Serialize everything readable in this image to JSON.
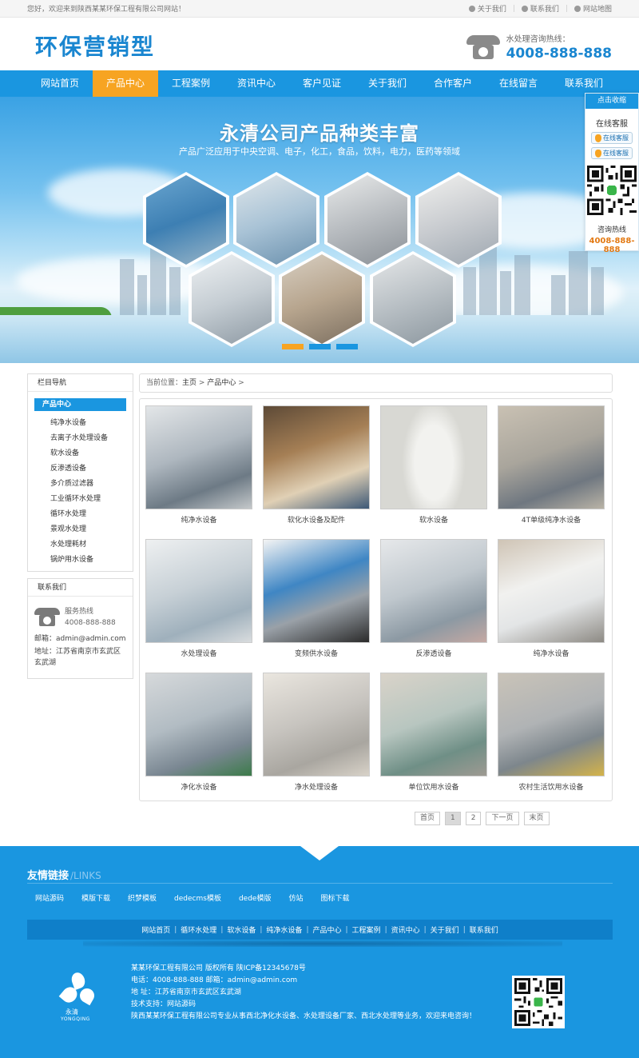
{
  "topbar": {
    "welcome": "您好，欢迎来到陕西某某环保工程有限公司网站！",
    "links": [
      "关于我们",
      "联系我们",
      "网站地图"
    ]
  },
  "header": {
    "logo": "环保营销型",
    "hotline_label": "水处理咨询热线：",
    "hotline_number": "4008-888-888"
  },
  "nav": {
    "items": [
      "网站首页",
      "产品中心",
      "工程案例",
      "资讯中心",
      "客户见证",
      "关于我们",
      "合作客户",
      "在线留言",
      "联系我们"
    ],
    "active_index": 1
  },
  "banner": {
    "title": "永清公司产品种类丰富",
    "subtitle": "产品广泛应用于中央空调、电子，化工，食品，饮料，电力，医药等领域",
    "slides": 3,
    "active_slide": 0
  },
  "float_service": {
    "header": "点击收缩",
    "title": "在线客服",
    "qq_buttons": [
      "在线客服",
      "在线客服"
    ],
    "consult_label": "咨询热线",
    "consult_number": "4008-888-888"
  },
  "sidebar": {
    "nav_title": "栏目导航",
    "active_category": "产品中心",
    "categories": [
      "纯净水设备",
      "去离子水处理设备",
      "软水设备",
      "反渗透设备",
      "多介质过滤器",
      "工业循环水处理",
      "循环水处理",
      "景观水处理",
      "水处理耗材",
      "锅炉用水设备"
    ],
    "contact_title": "联系我们",
    "service_label": "服务热线",
    "service_number": "4008-888-888",
    "email": "邮箱：admin@admin.com",
    "address": "地址：江苏省南京市玄武区玄武湖"
  },
  "breadcrumb": {
    "prefix": "当前位置：",
    "items": [
      "主页",
      "产品中心"
    ],
    "sep": ">"
  },
  "products": [
    "纯净水设备",
    "软化水设备及配件",
    "软水设备",
    "4T单级纯净水设备",
    "水处理设备",
    "变频供水设备",
    "反渗透设备",
    "纯净水设备",
    "净化水设备",
    "净水处理设备",
    "单位饮用水设备",
    "农村生活饮用水设备"
  ],
  "pagination": {
    "first": "首页",
    "pages": [
      "1",
      "2"
    ],
    "current": "1",
    "next": "下一页",
    "last": "末页"
  },
  "footer": {
    "links_title": "友情链接",
    "links_title_en": "/LINKS",
    "links": [
      "网站源码",
      "模版下载",
      "织梦模板",
      "dedecms模板",
      "dede模版",
      "仿站",
      "图标下载"
    ],
    "nav": [
      "网站首页",
      "循环水处理",
      "软水设备",
      "纯净水设备",
      "产品中心",
      "工程案例",
      "资讯中心",
      "关于我们",
      "联系我们"
    ],
    "info": [
      "某某环保工程有限公司 版权所有    陕ICP备12345678号",
      "电话：4008-888-888    邮箱：admin@admin.com",
      "地 址：江苏省南京市玄武区玄武湖",
      "技术支持：网站源码",
      "陕西某某环保工程有限公司专业从事西北净化水设备、水处理设备厂家、西北水处理等业务，欢迎来电咨询！"
    ],
    "logo_cn": "永清",
    "logo_en": "YONGQING"
  },
  "colors": {
    "primary": "#1a96e0",
    "accent": "#f7a422",
    "logo_blue": "#1a86d0"
  }
}
